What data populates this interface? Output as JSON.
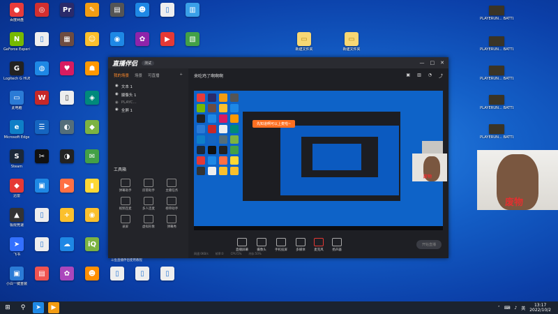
{
  "desktop": {
    "icons_col1": [
      {
        "label": "百度网盘",
        "color": "#e83b3b"
      },
      {
        "label": "GeForce Experience",
        "color": "#76b900"
      },
      {
        "label": "Logitech G HUB",
        "color": "#222"
      },
      {
        "label": "此电脑",
        "color": "#2b7bd6"
      },
      {
        "label": "Microsoft Edge",
        "color": "#0f7fc7"
      },
      {
        "label": "Steam",
        "color": "#1b2838"
      },
      {
        "label": "迅雷",
        "color": "#e53935"
      },
      {
        "label": "极限竞速",
        "color": "#333"
      },
      {
        "label": "飞书",
        "color": "#3370ff"
      },
      {
        "label": "小白一键重装",
        "color": "#2b7bd6"
      }
    ],
    "pubg": [
      {
        "label": "PLAYERUN... BATTLEGR..."
      },
      {
        "label": "PLAYERUN... BATTLEGR..."
      },
      {
        "label": "PLAYERUN... BATTLEGR..."
      },
      {
        "label": "PLAYERUN... BATTLEGR..."
      },
      {
        "label": "PLAYERUN... BATTLEGR..."
      },
      {
        "label": "PLAYERUN... BATTLEGR..."
      }
    ],
    "folders": [
      "新建文件夹",
      "新建文件夹"
    ]
  },
  "app": {
    "name": "直播伴侣",
    "badge": "测试",
    "tabs": [
      "我的场景",
      "场景",
      "可直播"
    ],
    "sources": [
      "文本 1",
      "摄像头 1",
      "PLAYC...",
      "全屏 1"
    ],
    "room_title": "来吃鸡了啊啊啊",
    "tools_title": "工具箱",
    "tools": [
      "弹幕助手",
      "房管助手",
      "主播任务",
      "视频连麦",
      "多人连麦",
      "榜单助手",
      "录屏",
      "虚拟形象",
      "弹幕秀",
      "礼物效果",
      "",
      ""
    ],
    "promo": "斗鱼直播伴侣使用教程",
    "toast": "先知道啊可以上麦啦~",
    "bottom_tools": [
      "直播屏幕",
      "摄像头",
      "手机投屏",
      "多媒体",
      "麦克风",
      "扬声器"
    ],
    "start_live": "开始直播",
    "status": [
      "网速:0KB/s",
      "帧率:0",
      "CPU:5%",
      "内存:50%"
    ]
  },
  "camera": {
    "caption": "废物"
  },
  "taskbar": {
    "time": "13:17",
    "date": "2022/10/2",
    "lang": "英",
    "start_icon": "windows-start-icon",
    "search_icon": "search-icon"
  }
}
